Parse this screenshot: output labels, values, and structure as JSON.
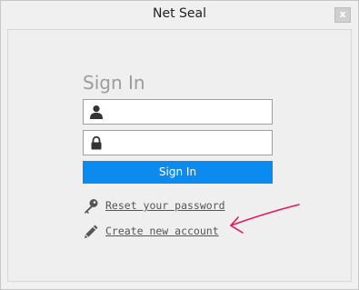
{
  "window": {
    "title": "Net Seal",
    "close_label": "x"
  },
  "form": {
    "heading": "Sign In",
    "username": {
      "value": "",
      "placeholder": "",
      "icon": "user-icon"
    },
    "password": {
      "value": "",
      "placeholder": "",
      "icon": "lock-icon"
    },
    "submit_label": "Sign In"
  },
  "links": {
    "reset": {
      "label": "Reset your password",
      "icon": "key-icon"
    },
    "create": {
      "label": "Create new account",
      "icon": "pencil-icon"
    }
  },
  "colors": {
    "accent": "#0b8aef",
    "annotation": "#e8175d",
    "heading": "#9c9c9c"
  }
}
